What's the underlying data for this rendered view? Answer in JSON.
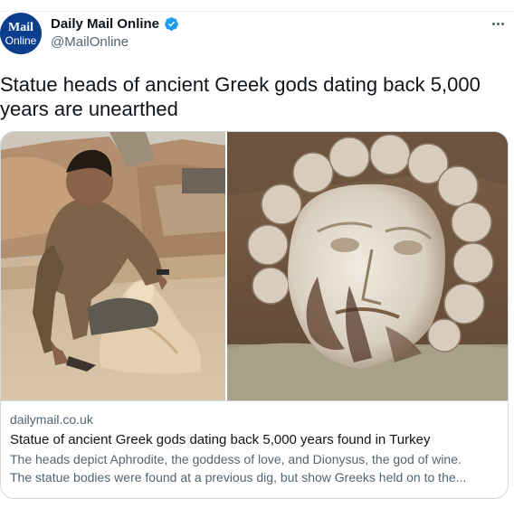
{
  "account": {
    "avatar_line1": "Mail",
    "avatar_line2": "Online",
    "display_name": "Daily Mail Online",
    "handle": "@MailOnline",
    "verified_icon": "verified-badge-icon",
    "more_icon": "more-options-icon"
  },
  "tweet": {
    "text": "Statue heads of ancient Greek gods dating back 5,000 years are unearthed"
  },
  "card": {
    "domain": "dailymail.co.uk",
    "title": "Statue of ancient Greek gods dating back 5,000 years found in Turkey",
    "description_line1": "The heads depict Aphrodite, the goddess of love, and Dionysus, the god of wine.",
    "description_line2": "The statue bodies were found at a previous dig, but show Greeks held on to the..."
  },
  "colors": {
    "brand_blue": "#0b3e8c",
    "verified_blue": "#1d9bf0",
    "secondary_text": "#536471",
    "border": "#cfd9de"
  }
}
